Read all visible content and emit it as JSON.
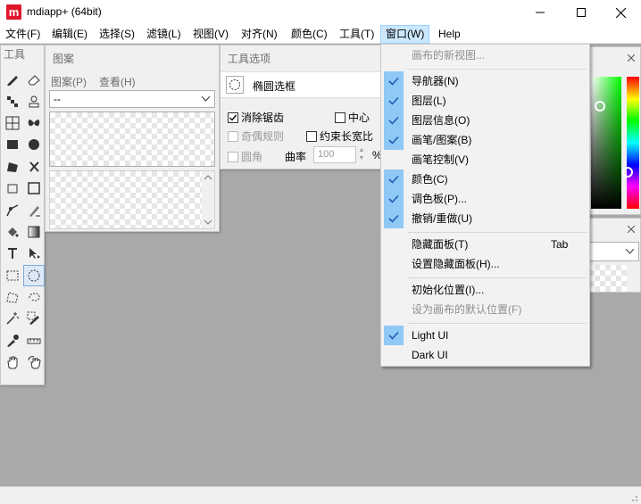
{
  "app": {
    "logo_letter": "m",
    "title": "mdiapp+ (64bit)"
  },
  "window_controls": {
    "minimize": "minimize",
    "maximize": "maximize",
    "close": "close"
  },
  "menubar": [
    {
      "label": "文件(F)"
    },
    {
      "label": "编辑(E)"
    },
    {
      "label": "选择(S)"
    },
    {
      "label": "滤镜(L)"
    },
    {
      "label": "视图(V)"
    },
    {
      "label": "对齐(N)"
    },
    {
      "label": "颜色(C)"
    },
    {
      "label": "工具(T)"
    },
    {
      "label": "窗口(W)",
      "active": true
    },
    {
      "label": "Help"
    }
  ],
  "tools_panel": {
    "title": "工具"
  },
  "pattern_panel": {
    "title": "图案",
    "menu_pattern": "图案(P)",
    "menu_view": "查看(H)",
    "select_value": "--"
  },
  "tool_options": {
    "title": "工具选项",
    "tool_name": "椭圆选框",
    "antialias": "消除锯齿",
    "center": "中心",
    "evenodd": "奇偶规则",
    "constrain": "约束长宽比",
    "round": "圆角",
    "curvature_label": "曲率",
    "curvature_value": "100",
    "percent": "%"
  },
  "window_menu": {
    "items": [
      {
        "label": "画布的新视图...",
        "disabled": true
      },
      {
        "label": "导航器(N)",
        "checked": true
      },
      {
        "label": "图层(L)",
        "checked": true
      },
      {
        "label": "图层信息(O)",
        "checked": true
      },
      {
        "label": "画笔/图案(B)",
        "checked": true
      },
      {
        "label": "画笔控制(V)"
      },
      {
        "label": "颜色(C)",
        "checked": true
      },
      {
        "label": "调色板(P)...",
        "checked": true
      },
      {
        "label": "撤销/重做(U)",
        "checked": true
      },
      {
        "label": "隐藏面板(T)",
        "shortcut": "Tab"
      },
      {
        "label": "设置隐藏面板(H)..."
      },
      {
        "label": "初始化位置(I)..."
      },
      {
        "label": "设为画布的默认位置(F)",
        "disabled": true
      },
      {
        "label": "Light UI",
        "checked": true
      },
      {
        "label": "Dark UI"
      }
    ]
  },
  "colors": {
    "accent_check_bg": "#90c8f6",
    "menu_active_bg": "#cce8ff",
    "workspace": "#a9a9a9",
    "logo": "#e0162b"
  }
}
